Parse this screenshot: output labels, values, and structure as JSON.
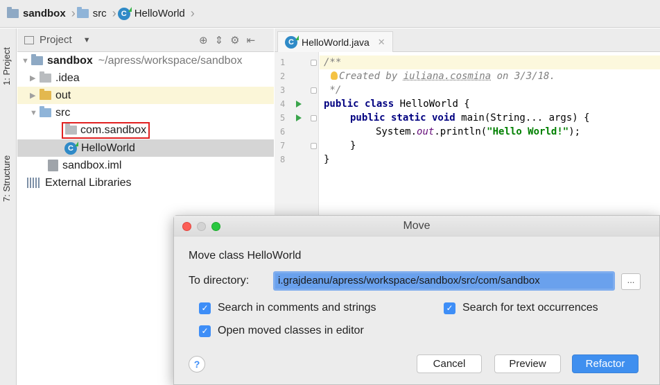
{
  "breadcrumb": {
    "project": "sandbox",
    "folder": "src",
    "file": "HelloWorld"
  },
  "toolstrip": {
    "project_tab": "1: Project",
    "structure_tab": "7: Structure"
  },
  "project_panel": {
    "title": "Project",
    "tree": {
      "root_name": "sandbox",
      "root_path": "~/apress/workspace/sandbox",
      "idea": ".idea",
      "out": "out",
      "src": "src",
      "package": "com.sandbox",
      "class": "HelloWorld",
      "iml": "sandbox.iml",
      "libs": "External Libraries"
    }
  },
  "editor": {
    "tab_label": "HelloWorld.java",
    "line_numbers": [
      "1",
      "2",
      "3",
      "4",
      "5",
      "6",
      "7",
      "8"
    ],
    "code": {
      "l1": "/**",
      "l2_prefix": "Created by ",
      "l2_author": "iuliana.cosmina",
      "l2_suffix": " on 3/3/18.",
      "l3": " */",
      "l4_kw": "public class",
      "l4_rest": " HelloWorld {",
      "l5_kw": "public static void",
      "l5_rest": " main(String... args) {",
      "l6_a": "System.",
      "l6_out": "out",
      "l6_b": ".println(",
      "l6_str": "\"Hello World!\"",
      "l6_c": ");",
      "l7": "}",
      "l8": "}"
    }
  },
  "dialog": {
    "title": "Move",
    "heading": "Move class HelloWorld",
    "dir_label": "To directory:",
    "dir_value": "i.grajdeanu/apress/workspace/sandbox/src/com/sandbox",
    "browse_label": "...",
    "search_comments": "Search in comments and strings",
    "search_text": "Search for text occurrences",
    "open_moved": "Open moved classes in editor",
    "help": "?",
    "cancel": "Cancel",
    "preview": "Preview",
    "refactor": "Refactor"
  },
  "colors": {
    "accent": "#3f8fef",
    "selection_box": "#e02020",
    "line_highlight": "#fcf8dd"
  }
}
